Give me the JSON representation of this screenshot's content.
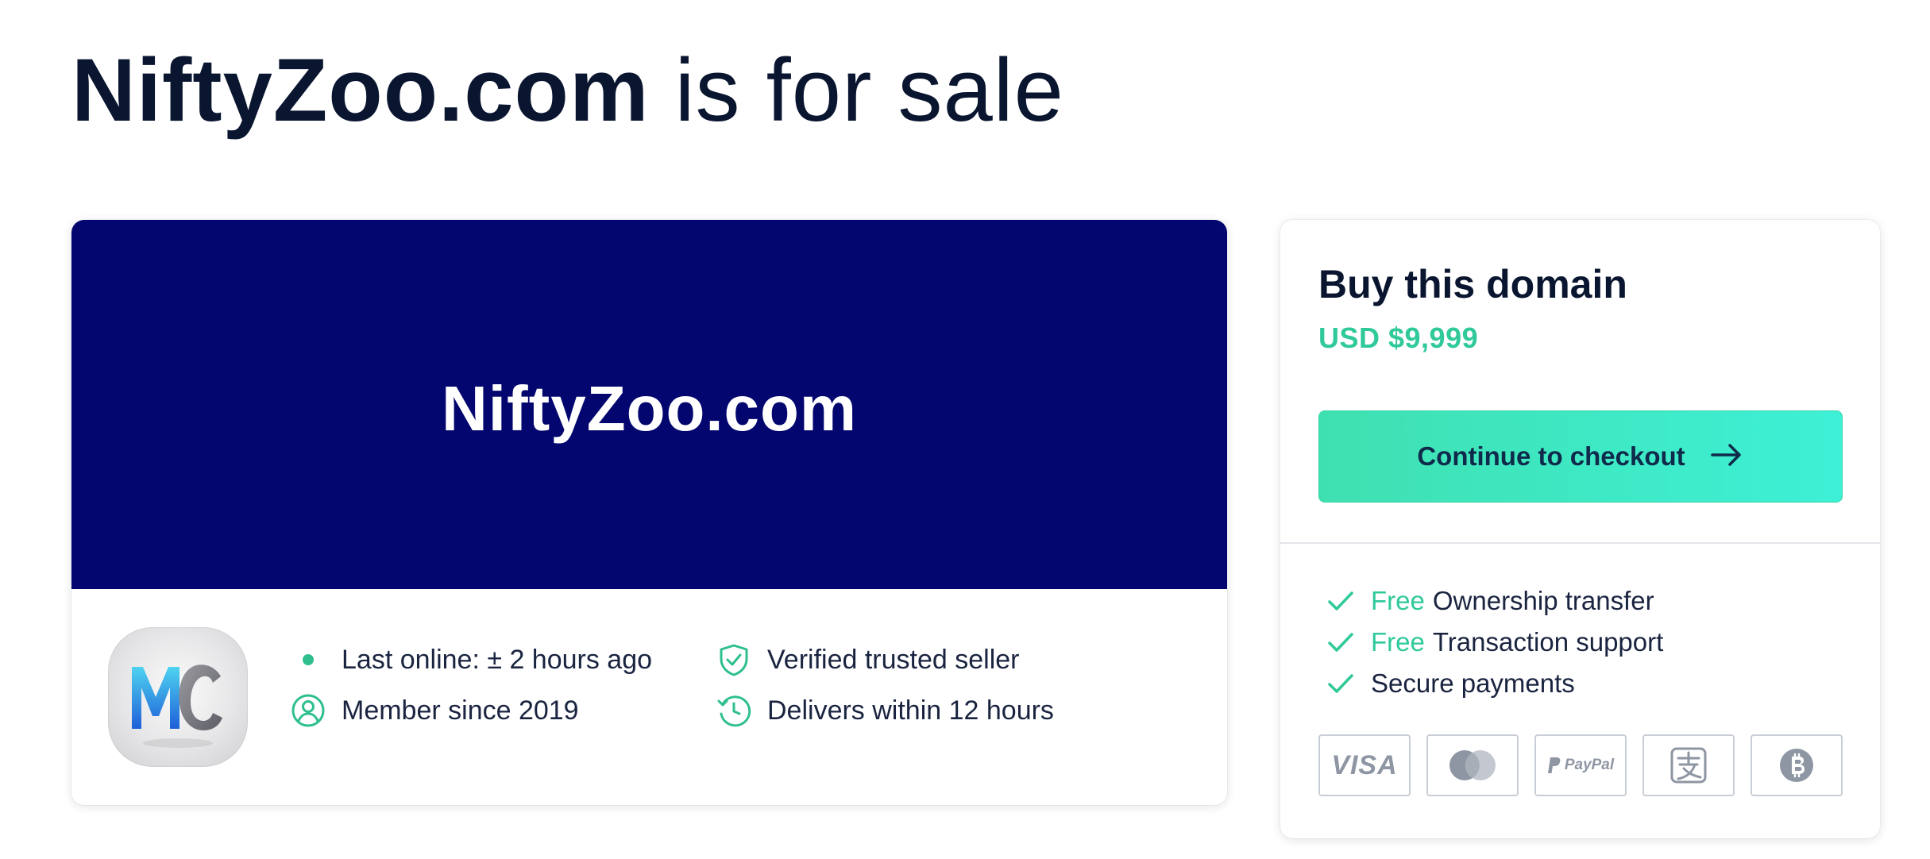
{
  "headline": {
    "domain": "NiftyZoo.com",
    "rest": "is for sale"
  },
  "banner": {
    "domain": "NiftyZoo.com",
    "background": "#03066f"
  },
  "seller": {
    "avatar_initials": "MC",
    "last_online": "Last online: ± 2 hours ago",
    "member_since": "Member since 2019",
    "verified": "Verified trusted seller",
    "delivers": "Delivers within 12 hours"
  },
  "buy": {
    "title": "Buy this domain",
    "price": "USD $9,999",
    "checkout_label": "Continue to checkout",
    "accent": "#2fc99a"
  },
  "features": [
    {
      "free": "Free",
      "label": "Ownership transfer"
    },
    {
      "free": "Free",
      "label": "Transaction support"
    },
    {
      "free": "",
      "label": "Secure payments"
    }
  ],
  "payments": [
    {
      "name": "visa",
      "text": "VISA"
    },
    {
      "name": "mastercard",
      "text": ""
    },
    {
      "name": "paypal",
      "text": "PayPal"
    },
    {
      "name": "alipay",
      "text": ""
    },
    {
      "name": "bitcoin",
      "text": ""
    }
  ],
  "icons": [
    "dot-icon",
    "user-circle-icon",
    "shield-check-icon",
    "clock-history-icon",
    "arrow-right-icon",
    "check-icon"
  ]
}
